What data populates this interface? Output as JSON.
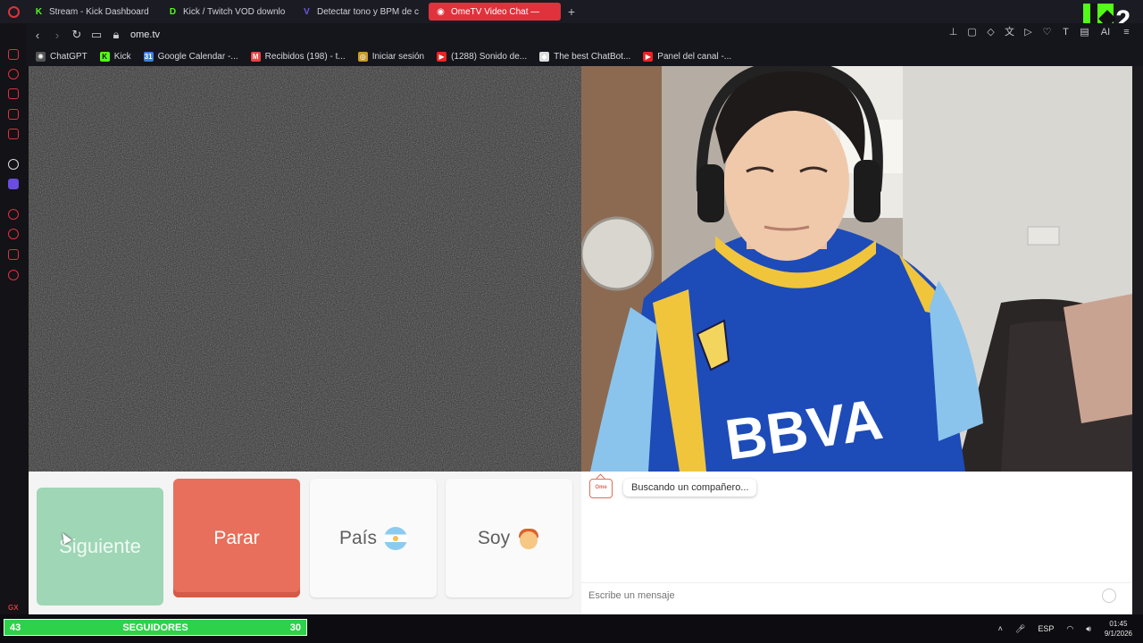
{
  "browser": {
    "tabs": [
      {
        "label": "Stream - Kick Dashboard",
        "icon": "K",
        "color": "#53fc18",
        "active": false
      },
      {
        "label": "Kick / Twitch VOD downlo",
        "icon": "D",
        "color": "#53fc18",
        "active": false
      },
      {
        "label": "Detectar tono y BPM de c",
        "icon": "V",
        "color": "#6a5ae0",
        "active": false
      },
      {
        "label": "OmeTV Video Chat —",
        "icon": "◉",
        "color": "#ffffff",
        "active": true
      }
    ],
    "new_tab": "+",
    "url": "ome.tv",
    "bookmarks": [
      {
        "label": "ChatGPT",
        "icon": "gpt",
        "color": "#555"
      },
      {
        "label": "Kick",
        "icon": "K",
        "color": "#53fc18"
      },
      {
        "label": "Google Calendar -...",
        "icon": "31",
        "color": "#3b7de9"
      },
      {
        "label": "Recibidos (198) - t...",
        "icon": "M",
        "color": "#e44"
      },
      {
        "label": "Iniciar sesión",
        "icon": "◎",
        "color": "#c89a2a"
      },
      {
        "label": "(1288) Sonido de...",
        "icon": "▶",
        "color": "#e22"
      },
      {
        "label": "The best ChatBot...",
        "icon": "◆",
        "color": "#ddd"
      },
      {
        "label": "Panel del canal -...",
        "icon": "▶",
        "color": "#e22"
      }
    ],
    "toolbar_right_ai": "AI"
  },
  "overlay": {
    "kick_number": "2"
  },
  "controls": {
    "next_label": "Siguiente",
    "stop_label": "Parar",
    "country_label": "País",
    "me_label": "Soy"
  },
  "chat": {
    "logo_text": "Ome",
    "status_message": "Buscando un compañero...",
    "input_placeholder": "Escribe un mensaje"
  },
  "stream_widget": {
    "current": "43",
    "label": "SEGUIDORES",
    "goal": "30"
  },
  "taskbar": {
    "lang": "ESP",
    "time": "01:45",
    "date": "9/1/2026"
  },
  "sidebar": {
    "gx_label": "GX",
    "more": "···"
  }
}
